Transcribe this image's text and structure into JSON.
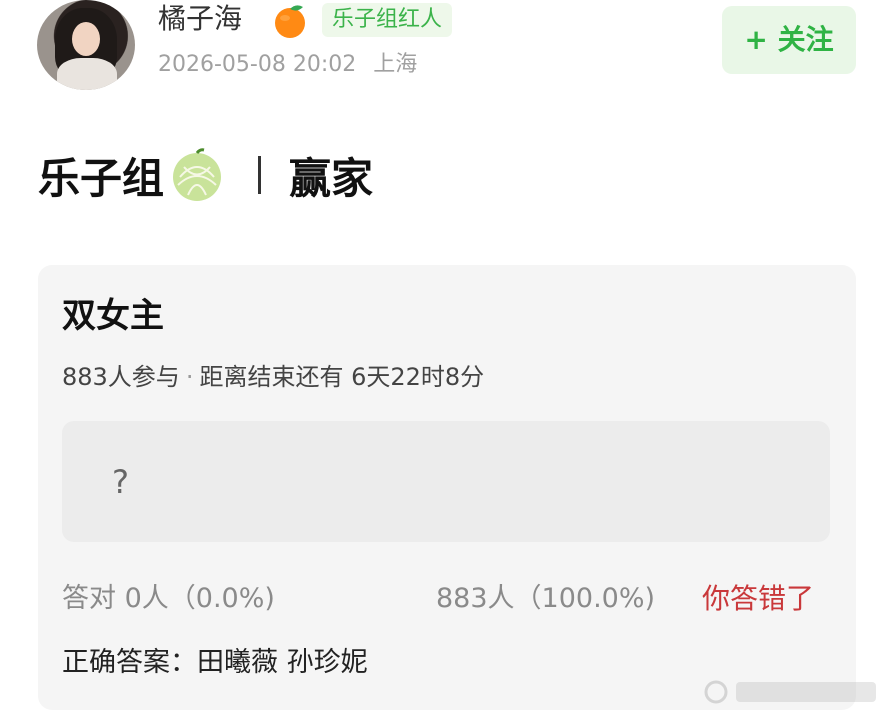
{
  "author": {
    "name": "橘子海",
    "badge": "乐子组红人",
    "timestamp": "2026-05-08 20:02",
    "location": "上海",
    "name_emoji_icon": "tangerine-icon"
  },
  "follow_button": {
    "label": "+ 关注",
    "color": "#2fb344"
  },
  "post": {
    "title_left": "乐子组",
    "title_icon": "melon-icon",
    "title_right": "赢家"
  },
  "quiz": {
    "title": "双女主",
    "participants": "883人参与",
    "time_left": "距离结束还有 6天22时8分",
    "answer_placeholder": "?",
    "correct_stat": "答对  0人（0.0%)",
    "wrong_stat": "883人（100.0%)",
    "result_label": "你答错了",
    "correct_answer": "正确答案：田曦薇 孙珍妮"
  },
  "colors": {
    "accent_green": "#2fb344",
    "badge_bg": "#eef8ea",
    "error_red": "#c9383a",
    "card_bg": "#f5f5f5"
  }
}
